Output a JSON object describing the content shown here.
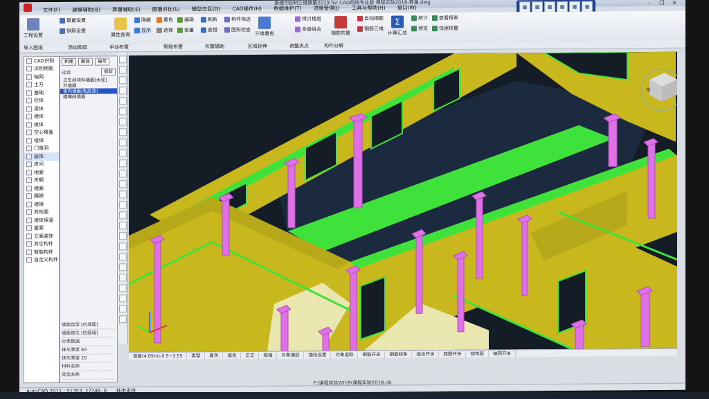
{
  "window": {
    "title": "斯维尔BIM三维算量2019 for CAD网络专业版  课程实验2018-算量.dwg"
  },
  "menu": [
    "文件(F)",
    "建模辅助(B)",
    "算量辅助(E)",
    "图量对比(L)",
    "模型交互(D)",
    "CAD操作(H)",
    "数据维护(T)",
    "进度管理(J)",
    "工具与帮助(H)",
    "窗口(W)"
  ],
  "quick_icons": [
    "grid-icon",
    "cube-icon",
    "layers-icon",
    "table-icon",
    "chart-icon",
    "list-icon"
  ],
  "ribbon": {
    "project_settings": "工程设置",
    "calc_settings": "算量设置",
    "rebar_settings": "钢筋设置",
    "attr_query": "属性查询",
    "hide": "隐藏",
    "show": "显示",
    "color": "着色",
    "select": "选择",
    "query": "查量",
    "edit": "编辑",
    "refresh": "刷新",
    "check": "查错",
    "component_filter": "构件筛选",
    "rebar_layout": "钢筋布置",
    "graphic_check": "图形检查",
    "three_d_color": "三维着色",
    "copy_floor": "拷贝楼层",
    "multi_combine": "多层组合",
    "auto_rebar": "自动钢筋",
    "rebar_3d": "钢筋三维",
    "calc_total": "计算汇总",
    "stats": "统计",
    "preview": "预览",
    "query_report": "查看报表",
    "quick_verify": "快速核量"
  },
  "toolbar2": [
    "导入图纸",
    "添加图层",
    "手动布置",
    "智能布置",
    "布置辅助",
    "区域延伸",
    "调整夹点",
    "构件分解"
  ],
  "tree": [
    {
      "label": "CAD识别",
      "icon": "cad-icon"
    },
    {
      "label": "识别钢筋",
      "icon": "rebar-icon"
    },
    {
      "label": "轴网",
      "icon": "grid-icon"
    },
    {
      "label": "土方",
      "icon": "earth-icon"
    },
    {
      "label": "基础",
      "icon": "foundation-icon"
    },
    {
      "label": "柱体",
      "icon": "column-icon"
    },
    {
      "label": "梁体",
      "icon": "beam-icon"
    },
    {
      "label": "墙体",
      "icon": "wall-icon"
    },
    {
      "label": "板体",
      "icon": "slab-icon"
    },
    {
      "label": "空心楼盖",
      "icon": "hollow-icon"
    },
    {
      "label": "楼梯",
      "icon": "stair-icon"
    },
    {
      "label": "门窗洞",
      "icon": "door-icon"
    },
    {
      "label": "装饰",
      "icon": "deco-icon"
    },
    {
      "label": "房间",
      "icon": "room-icon"
    },
    {
      "label": "地面",
      "icon": "floor-icon"
    },
    {
      "label": "天棚",
      "icon": "ceiling-icon"
    },
    {
      "label": "墙面",
      "icon": "wallface-icon"
    },
    {
      "label": "踢脚",
      "icon": "skirting-icon"
    },
    {
      "label": "墙裙",
      "icon": "dado-icon"
    },
    {
      "label": "其他面",
      "icon": "otherface-icon"
    },
    {
      "label": "墙体保温",
      "icon": "insulation-icon"
    },
    {
      "label": "屋面",
      "icon": "roof-icon"
    },
    {
      "label": "立面装饰",
      "icon": "facade-icon"
    },
    {
      "label": "其它构件",
      "icon": "other-icon"
    },
    {
      "label": "智能构件",
      "icon": "smart-icon"
    },
    {
      "label": "自定义构件",
      "icon": "custom-icon"
    }
  ],
  "panel": {
    "buttons": [
      "新建",
      "删除",
      "编号"
    ],
    "filter_label": "过滤",
    "filter_button": "提取",
    "items": [
      "卫生间块料墙面[水泥]",
      "外墙面",
      "室内墙面(乳胶漆)",
      "楼梯间墙面"
    ],
    "properties": [
      "墙面类型 [内墙面]",
      "墙面部位 [四面墙]",
      "分类数据",
      "抹灰厚度 60",
      "抹灰厚度 20",
      "材料名称",
      "类型名称"
    ]
  },
  "viewport": {
    "nav_cube_label": "东",
    "bg": "#141c26",
    "wall_color": "#c8b81e",
    "beam_color": "#3fe23a",
    "column_color": "#e070e6"
  },
  "statusbar": [
    "首层(4.05m)-0.5~3.55",
    "类型",
    "着色",
    "填充",
    "正交",
    "极轴",
    "对象捕捉",
    "描绘设置",
    "对象追踪",
    "钢筋开关",
    "钢筋线条",
    "组合开关",
    "底图开关",
    "结构层",
    "轴网开关"
  ],
  "file_path": "F:\\课程实验2018\\课程实验2018.db",
  "coords": "AutoCAD 2011 : 51353, 27248, 0",
  "badge": "技术支持"
}
